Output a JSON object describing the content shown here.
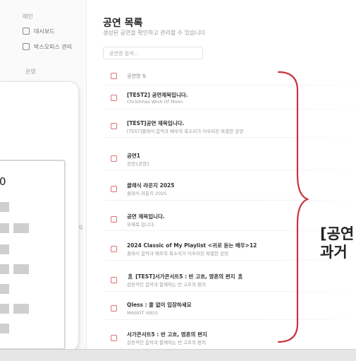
{
  "sidebar": {
    "section_main": "메인",
    "items": [
      {
        "label": "대시보드",
        "icon": "home-icon"
      },
      {
        "label": "박스오피스 관리",
        "icon": "box-icon"
      }
    ],
    "section_ops": "운영",
    "partial_label": "리"
  },
  "header": {
    "title": "공연 목록",
    "subtitle": "생성된 공연을 확인하고 관리할 수 있습니다"
  },
  "search": {
    "placeholder": "공연명 검색..."
  },
  "table": {
    "column_header": "공연명 ⇅",
    "rows": [
      {
        "title": "[TEST2] 공연제목입니다.",
        "subtitle": "Christmas Wish Of Moon"
      },
      {
        "title": "[TEST]공연 제목입니다.",
        "subtitle": "[TEST]클래식 음악과 배우의 목소리가 어우러진 특별한 공연"
      },
      {
        "title": "공연1",
        "subtitle": "공연1공연1"
      },
      {
        "title": "클래식 라운지 2025",
        "subtitle": "클래식 라운지 2025"
      },
      {
        "title": "공연 제목입니다.",
        "subtitle": "부제목 입니다."
      },
      {
        "title": "2024 Classic of My Playlist <귀로 듣는 배우>12",
        "subtitle": "클래식 음악과 배우의 목소리가 어우러진 특별한 공연"
      },
      {
        "title": "🎗 [TEST]서가콘서트5 : 반 고흐, 영혼의 편지 🎗",
        "subtitle": "감동적인 음악과 함께하는 반 고흐의 편지"
      },
      {
        "title": "Qless : 줄 없이 입장하세요",
        "subtitle": "MASKIT 서비스"
      },
      {
        "title": "서가콘서트5 : 반 고흐, 영혼의 편지",
        "subtitle": "감동적인 음악과 함께하는 반 고흐의 편지"
      }
    ]
  },
  "card": {
    "number": "0"
  },
  "caption": {
    "line1": "[공연",
    "line2": "과거"
  },
  "colors": {
    "accent": "#c8343f",
    "checkbox": "#e07070"
  }
}
